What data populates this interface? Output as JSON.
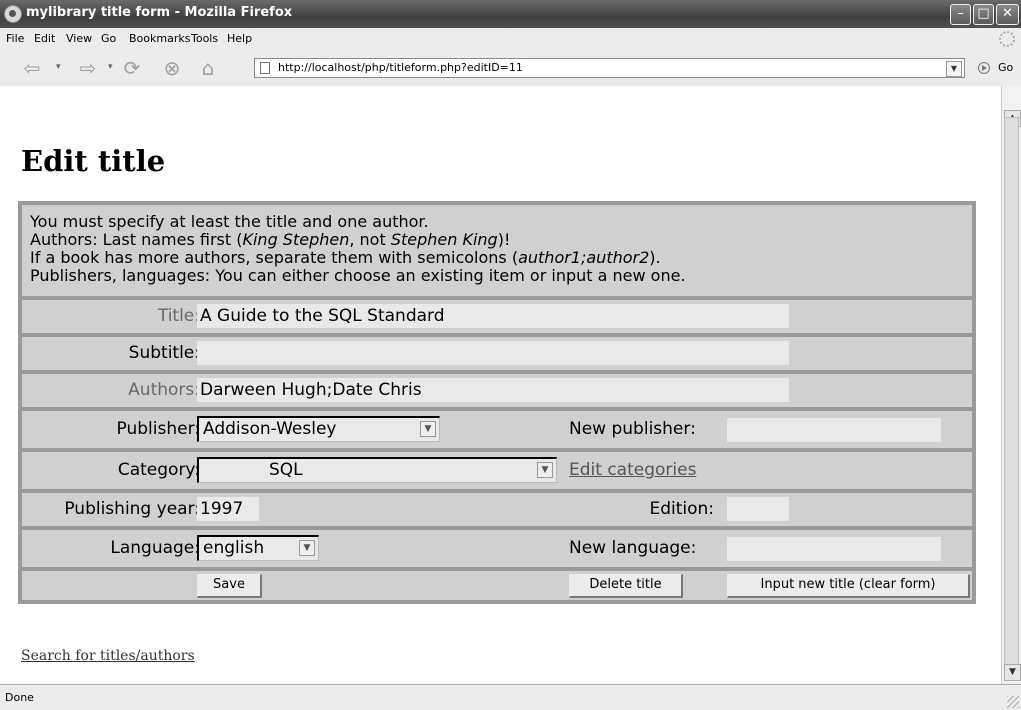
{
  "window": {
    "title": "mylibrary title form - Mozilla Firefox",
    "min_icon": "minimize-icon",
    "max_icon": "maximize-icon",
    "close_icon": "close-icon"
  },
  "menu": {
    "items": [
      "File",
      "Edit",
      "View",
      "Go",
      "Bookmarks",
      "Tools",
      "Help"
    ]
  },
  "nav": {
    "url": "http://localhost/php/titleform.php?editID=11",
    "go_label": "Go"
  },
  "page": {
    "heading": "Edit title",
    "instructions": [
      "You must specify at least the title and one author.",
      "Authors: Last names first (",
      "King Stephen",
      ", not ",
      "Stephen King",
      ")!",
      "If a book has more authors, separate them with semicolons (",
      "author1;author2",
      ").",
      "Publishers, languages: You can either choose an existing item or input a new one."
    ],
    "form": {
      "title_label": "Title:",
      "title_value": "A Guide to the SQL Standard",
      "subtitle_label": "Subtitle:",
      "subtitle_value": "",
      "authors_label": "Authors:",
      "authors_value": "Darween Hugh;Date Chris",
      "publisher_label": "Publisher:",
      "publisher_value": "Addison-Wesley",
      "new_publisher_label": "New publisher:",
      "new_publisher_value": "",
      "category_label": "Category:",
      "category_value": "SQL",
      "edit_categories_link": "Edit categories",
      "year_label": "Publishing year:",
      "year_value": "1997",
      "edition_label": "Edition:",
      "edition_value": "",
      "language_label": "Language:",
      "language_value": "english",
      "new_language_label": "New language:",
      "new_language_value": "",
      "save_button": "Save",
      "delete_button": "Delete title",
      "new_title_button": "Input new title (clear form)"
    },
    "search_link": "Search for titles/authors"
  },
  "status": {
    "text": "Done"
  },
  "colors": {
    "form_border": "#9a9a9a",
    "row_bg": "#d0d0d0",
    "field_bg": "#e9e9e9"
  }
}
